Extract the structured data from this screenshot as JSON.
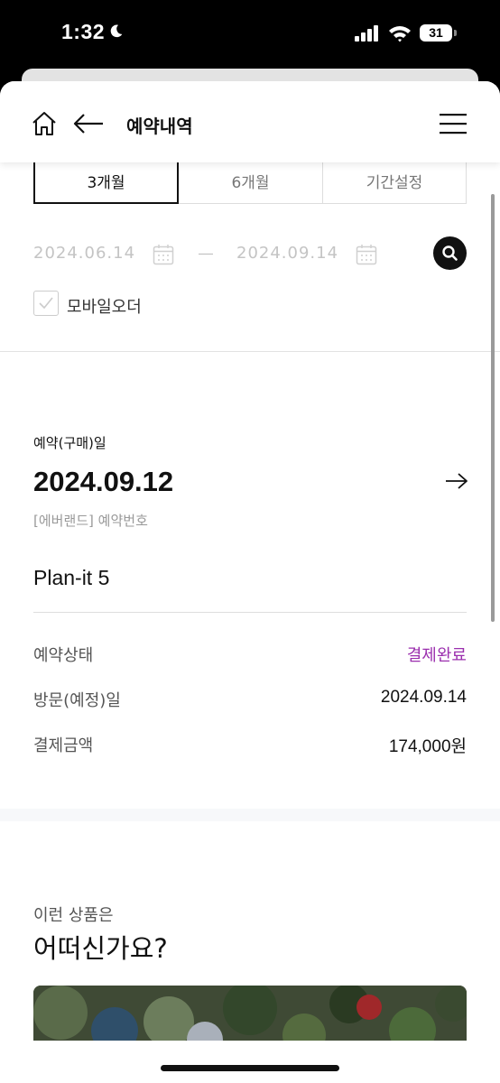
{
  "status_bar": {
    "time": "1:32",
    "battery": "31"
  },
  "header": {
    "title": "예약내역"
  },
  "tabs": [
    {
      "label": "3개월",
      "active": true
    },
    {
      "label": "6개월",
      "active": false
    },
    {
      "label": "기간설정",
      "active": false
    }
  ],
  "date_filter": {
    "start": "2024.06.14",
    "separator": "–",
    "end": "2024.09.14"
  },
  "filter": {
    "mobile_order_label": "모바일오더",
    "mobile_order_checked": false
  },
  "order": {
    "date_label": "예약(구매)일",
    "date": "2024.09.12",
    "reservation_label": "[에버랜드] 예약번호",
    "product": "Plan-it 5",
    "details": [
      {
        "label": "예약상태",
        "value": "결제완료"
      },
      {
        "label": "방문(예정)일",
        "value": "2024.09.14"
      },
      {
        "label": "결제금액",
        "value": "174,000원"
      }
    ]
  },
  "recommend": {
    "subtitle": "이런 상품은",
    "title": "어떠신가요?"
  },
  "colors": {
    "accent_status": "#9b2fae",
    "text": "#111111",
    "muted": "#999999"
  }
}
